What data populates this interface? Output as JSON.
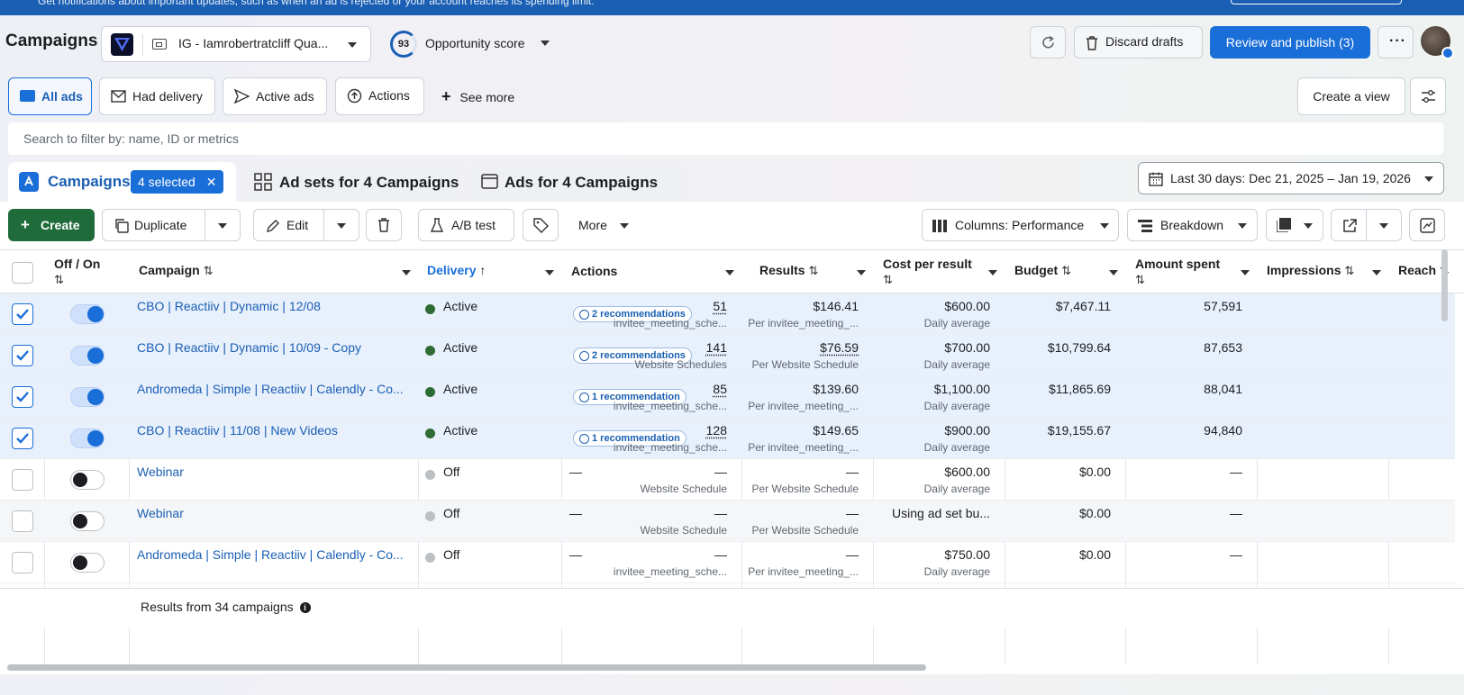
{
  "notice": {
    "message": "Get notifications about important updates, such as when an ad is rejected or your account reaches its spending limit."
  },
  "header": {
    "title": "Campaigns",
    "account_name": "IG - Iamrobertratcliff Qua...",
    "opportunity_score": "93",
    "opportunity_label": "Opportunity score",
    "discard_label": "Discard drafts",
    "publish_label": "Review and publish (3)"
  },
  "filters": {
    "all_ads": "All ads",
    "had_delivery": "Had delivery",
    "active_ads": "Active ads",
    "actions": "Actions",
    "see_more": "See more",
    "create_view": "Create a view"
  },
  "search": {
    "placeholder": "Search to filter by: name, ID or metrics"
  },
  "tabs": {
    "campaigns": "Campaigns",
    "selected": "4 selected",
    "ad_sets": "Ad sets for 4 Campaigns",
    "ads": "Ads for 4 Campaigns"
  },
  "date_range": "Last 30 days: Dec 21, 2025 – Jan 19, 2026",
  "toolbar": {
    "create": "Create",
    "duplicate": "Duplicate",
    "edit": "Edit",
    "ab_test": "A/B test",
    "more": "More",
    "columns": "Columns: Performance",
    "breakdown": "Breakdown"
  },
  "table": {
    "headers": {
      "off_on": "Off / On",
      "campaign": "Campaign",
      "delivery": "Delivery",
      "actions": "Actions",
      "results": "Results",
      "cost_per_result": "Cost per result",
      "budget": "Budget",
      "amount_spent": "Amount spent",
      "impressions": "Impressions",
      "reach": "Reach"
    },
    "rows": [
      {
        "selected": true,
        "on": true,
        "campaign": "CBO | Reactiiv | Dynamic | 12/08",
        "delivery": "Active",
        "delivery_color": "#2f6b34",
        "actions": "2 recommendations",
        "results": "51",
        "results_sub": "invitee_meeting_sche...",
        "cost": "$146.41",
        "cost_sub": "Per invitee_meeting_...",
        "budget": "$600.00",
        "budget_sub": "Daily average",
        "spent": "$7,467.11",
        "impressions": "57,591"
      },
      {
        "selected": true,
        "on": true,
        "campaign": "CBO | Reactiiv | Dynamic | 10/09 - Copy",
        "delivery": "Active",
        "delivery_color": "#2f6b34",
        "actions": "2 recommendations",
        "results": "141",
        "results_sub": "Website Schedules",
        "cost": "$76.59",
        "cost_sub": "Per Website Schedule",
        "budget": "$700.00",
        "budget_sub": "Daily average",
        "spent": "$10,799.64",
        "impressions": "87,653"
      },
      {
        "selected": true,
        "on": true,
        "campaign": "Andromeda | Simple | Reactiiv | Calendly - Co...",
        "delivery": "Active",
        "delivery_color": "#2f6b34",
        "actions": "1 recommendation",
        "results": "85",
        "results_sub": "invitee_meeting_sche...",
        "cost": "$139.60",
        "cost_sub": "Per invitee_meeting_...",
        "budget": "$1,100.00",
        "budget_sub": "Daily average",
        "spent": "$11,865.69",
        "impressions": "88,041"
      },
      {
        "selected": true,
        "on": true,
        "campaign": "CBO | Reactiiv | 11/08 | New Videos",
        "delivery": "Active",
        "delivery_color": "#2f6b34",
        "actions": "1 recommendation",
        "results": "128",
        "results_sub": "invitee_meeting_sche...",
        "cost": "$149.65",
        "cost_sub": "Per invitee_meeting_...",
        "budget": "$900.00",
        "budget_sub": "Daily average",
        "spent": "$19,155.67",
        "impressions": "94,840"
      },
      {
        "selected": false,
        "on": false,
        "campaign": "Webinar",
        "delivery": "Off",
        "delivery_color": "#bcc0c4",
        "actions": "—",
        "results": "—",
        "results_sub": "Website Schedule",
        "cost": "—",
        "cost_sub": "Per Website Schedule",
        "budget": "$600.00",
        "budget_sub": "Daily average",
        "spent": "$0.00",
        "impressions": "—"
      },
      {
        "selected": false,
        "on": false,
        "campaign": "Webinar",
        "delivery": "Off",
        "delivery_color": "#bcc0c4",
        "actions": "—",
        "results": "—",
        "results_sub": "Website Schedule",
        "cost": "—",
        "cost_sub": "Per Website Schedule",
        "budget": "Using ad set bu...",
        "budget_sub": "",
        "spent": "$0.00",
        "impressions": "—"
      },
      {
        "selected": false,
        "on": false,
        "campaign": "Andromeda | Simple | Reactiiv | Calendly - Co...",
        "delivery": "Off",
        "delivery_color": "#bcc0c4",
        "actions": "—",
        "results": "—",
        "results_sub": "invitee_meeting_sche...",
        "cost": "—",
        "cost_sub": "Per invitee_meeting_...",
        "budget": "$750.00",
        "budget_sub": "Daily average",
        "spent": "$0.00",
        "impressions": "—"
      }
    ],
    "footer": "Results from 34 campaigns"
  },
  "colors": {
    "accent": "#1a6ed8",
    "create_green": "#1f6b3a",
    "active_dot": "#2f6b34",
    "off_dot": "#bcc0c4"
  }
}
